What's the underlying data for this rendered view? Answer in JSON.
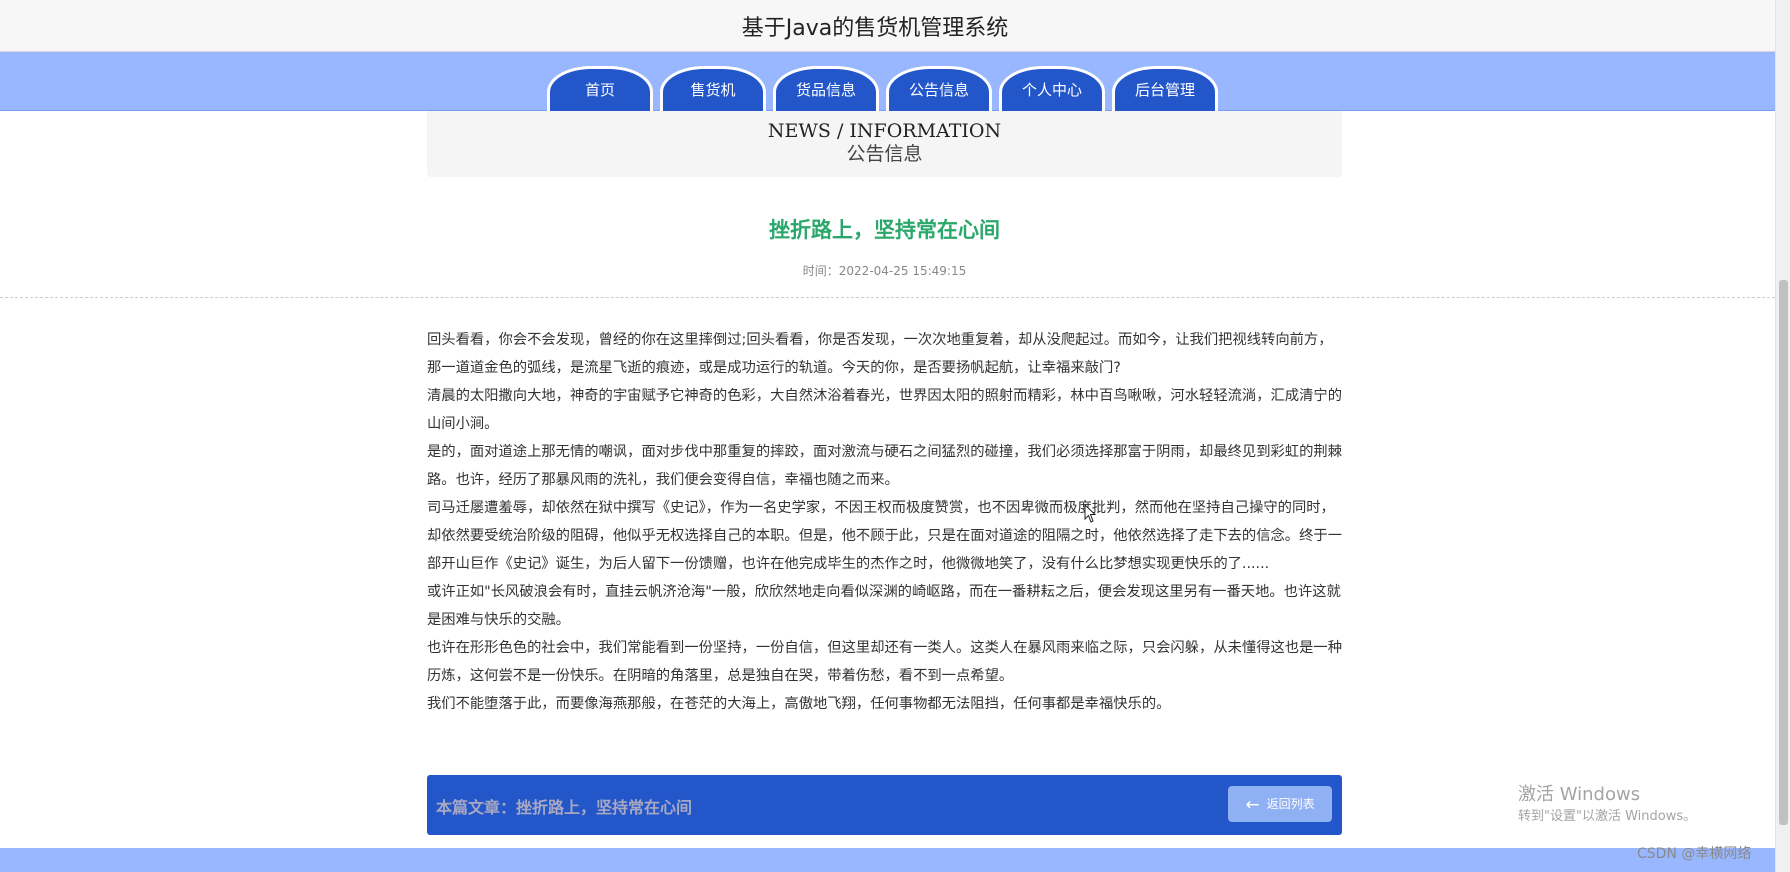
{
  "site": {
    "title": "基于Java的售货机管理系统"
  },
  "nav": {
    "tabs": [
      {
        "label": "首页"
      },
      {
        "label": "售货机"
      },
      {
        "label": "货品信息"
      },
      {
        "label": "公告信息"
      },
      {
        "label": "个人中心"
      },
      {
        "label": "后台管理"
      }
    ]
  },
  "news_header": {
    "en": "NEWS / INFORMATION",
    "cn": "公告信息"
  },
  "article": {
    "title": "挫折路上，坚持常在心间",
    "time_label": "时间：",
    "time_value": "2022-04-25 15:49:15",
    "paragraphs": [
      "回头看看，你会不会发现，曾经的你在这里摔倒过;回头看看，你是否发现，一次次地重复着，却从没爬起过。而如今，让我们把视线转向前方，那一道道金色的弧线，是流星飞逝的痕迹，或是成功运行的轨道。今天的你，是否要扬帆起航，让幸福来敲门?",
      "清晨的太阳撒向大地，神奇的宇宙赋予它神奇的色彩，大自然沐浴着春光，世界因太阳的照射而精彩，林中百鸟啾啾，河水轻轻流淌，汇成清宁的山间小涧。",
      "是的，面对道途上那无情的嘲讽，面对步伐中那重复的摔跤，面对激流与硬石之间猛烈的碰撞，我们必须选择那富于阴雨，却最终见到彩虹的荆棘路。也许，经历了那暴风雨的洗礼，我们便会变得自信，幸福也随之而来。",
      "司马迁屡遭羞辱，却依然在狱中撰写《史记》，作为一名史学家，不因王权而极度赞赏，也不因卑微而极度批判，然而他在坚持自己操守的同时，却依然要受统治阶级的阻碍，他似乎无权选择自己的本职。但是，他不顾于此，只是在面对道途的阻隔之时，他依然选择了走下去的信念。终于一部开山巨作《史记》诞生，为后人留下一份馈赠，也许在他完成毕生的杰作之时，他微微地笑了，没有什么比梦想实现更快乐的了......",
      "或许正如\"长风破浪会有时，直挂云帆济沧海\"一般，欣欣然地走向看似深渊的崎岖路，而在一番耕耘之后，便会发现这里另有一番天地。也许这就是困难与快乐的交融。",
      "也许在形形色色的社会中，我们常能看到一份坚持，一份自信，但这里却还有一类人。这类人在暴风雨来临之际，只会闪躲，从未懂得这也是一种历炼，这何尝不是一份快乐。在阴暗的角落里，总是独自在哭，带着伤愁，看不到一点希望。",
      "我们不能堕落于此，而要像海燕那般，在苍茫的大海上，高傲地飞翔，任何事物都无法阻挡，任何事都是幸福快乐的。"
    ]
  },
  "footer": {
    "label": "本篇文章：",
    "value": "挫折路上，坚持常在心间",
    "back_label": "返回列表",
    "back_icon": "arrow-left-icon"
  },
  "watermark": {
    "line1": "激活 Windows",
    "line2": "转到\"设置\"以激活 Windows。",
    "csdn": "CSDN @幸横网络"
  },
  "colors": {
    "nav_bar": "#98b7ff",
    "nav_tab": "#2357c9",
    "title_green": "#2aa76b",
    "footer_blue": "#2357c9"
  }
}
